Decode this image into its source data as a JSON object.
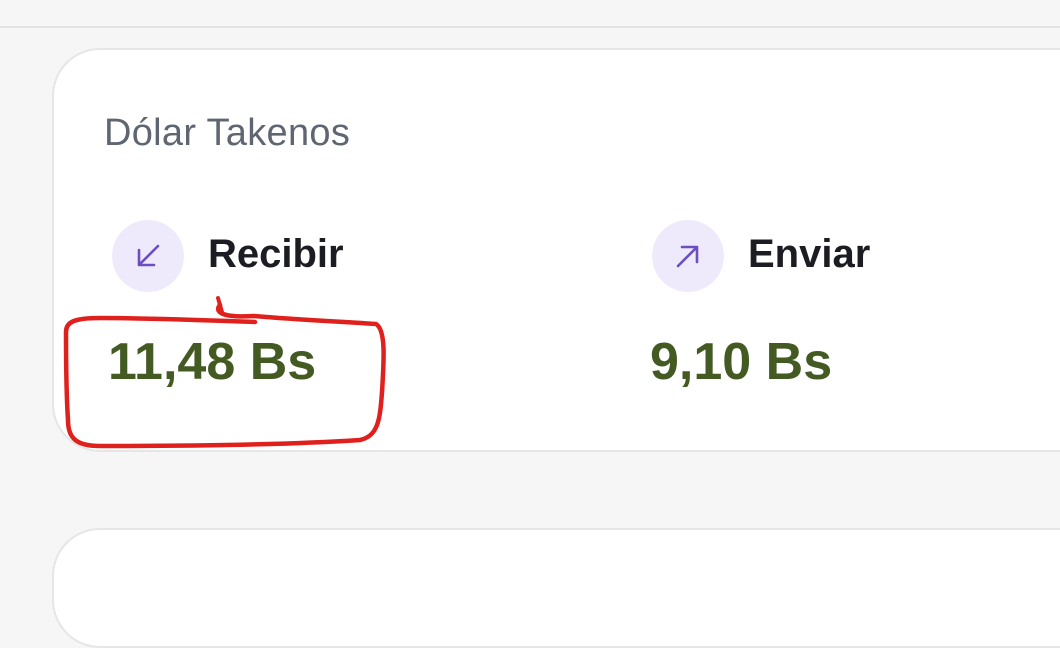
{
  "card": {
    "title": "Dólar Takenos",
    "receive": {
      "label": "Recibir",
      "amount": "11,48 Bs",
      "icon": "arrow-down-left-icon"
    },
    "send": {
      "label": "Enviar",
      "amount": "9,10 Bs",
      "icon": "arrow-up-right-icon"
    }
  },
  "colors": {
    "background": "#f6f6f6",
    "card": "#ffffff",
    "title": "#5f6672",
    "label": "#1b1d22",
    "amount": "#445a23",
    "icon_bg": "#efeafb",
    "icon_stroke": "#6b4fc0",
    "annotation": "#e0201c"
  }
}
